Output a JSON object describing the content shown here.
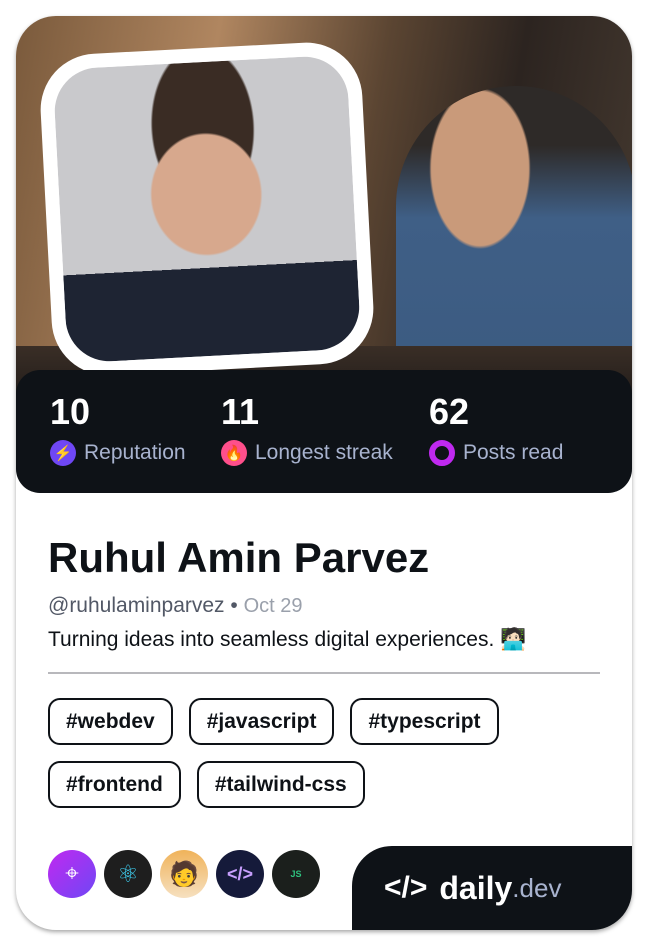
{
  "stats": [
    {
      "value": "10",
      "label": "Reputation",
      "icon": "lightning-icon",
      "color": "#6f47f5"
    },
    {
      "value": "11",
      "label": "Longest streak",
      "icon": "flame-icon",
      "color": "#ff4f8b"
    },
    {
      "value": "62",
      "label": "Posts read",
      "icon": "ring-icon",
      "color": "#c029f0"
    }
  ],
  "profile": {
    "name": "Ruhul Amin Parvez",
    "handle": "@ruhulaminparvez",
    "separator": "•",
    "date": "Oct 29",
    "bio": "Turning ideas into seamless digital experiences. 🧑🏻‍💻"
  },
  "tags": [
    "#webdev",
    "#javascript",
    "#typescript",
    "#frontend",
    "#tailwind-css"
  ],
  "squads": [
    "crosshair-squad",
    "react-squad",
    "developer-memoji-squad",
    "code-squad",
    "javascript-frameworks-squad"
  ],
  "logo": {
    "brand": "daily",
    "suffix": ".dev"
  }
}
